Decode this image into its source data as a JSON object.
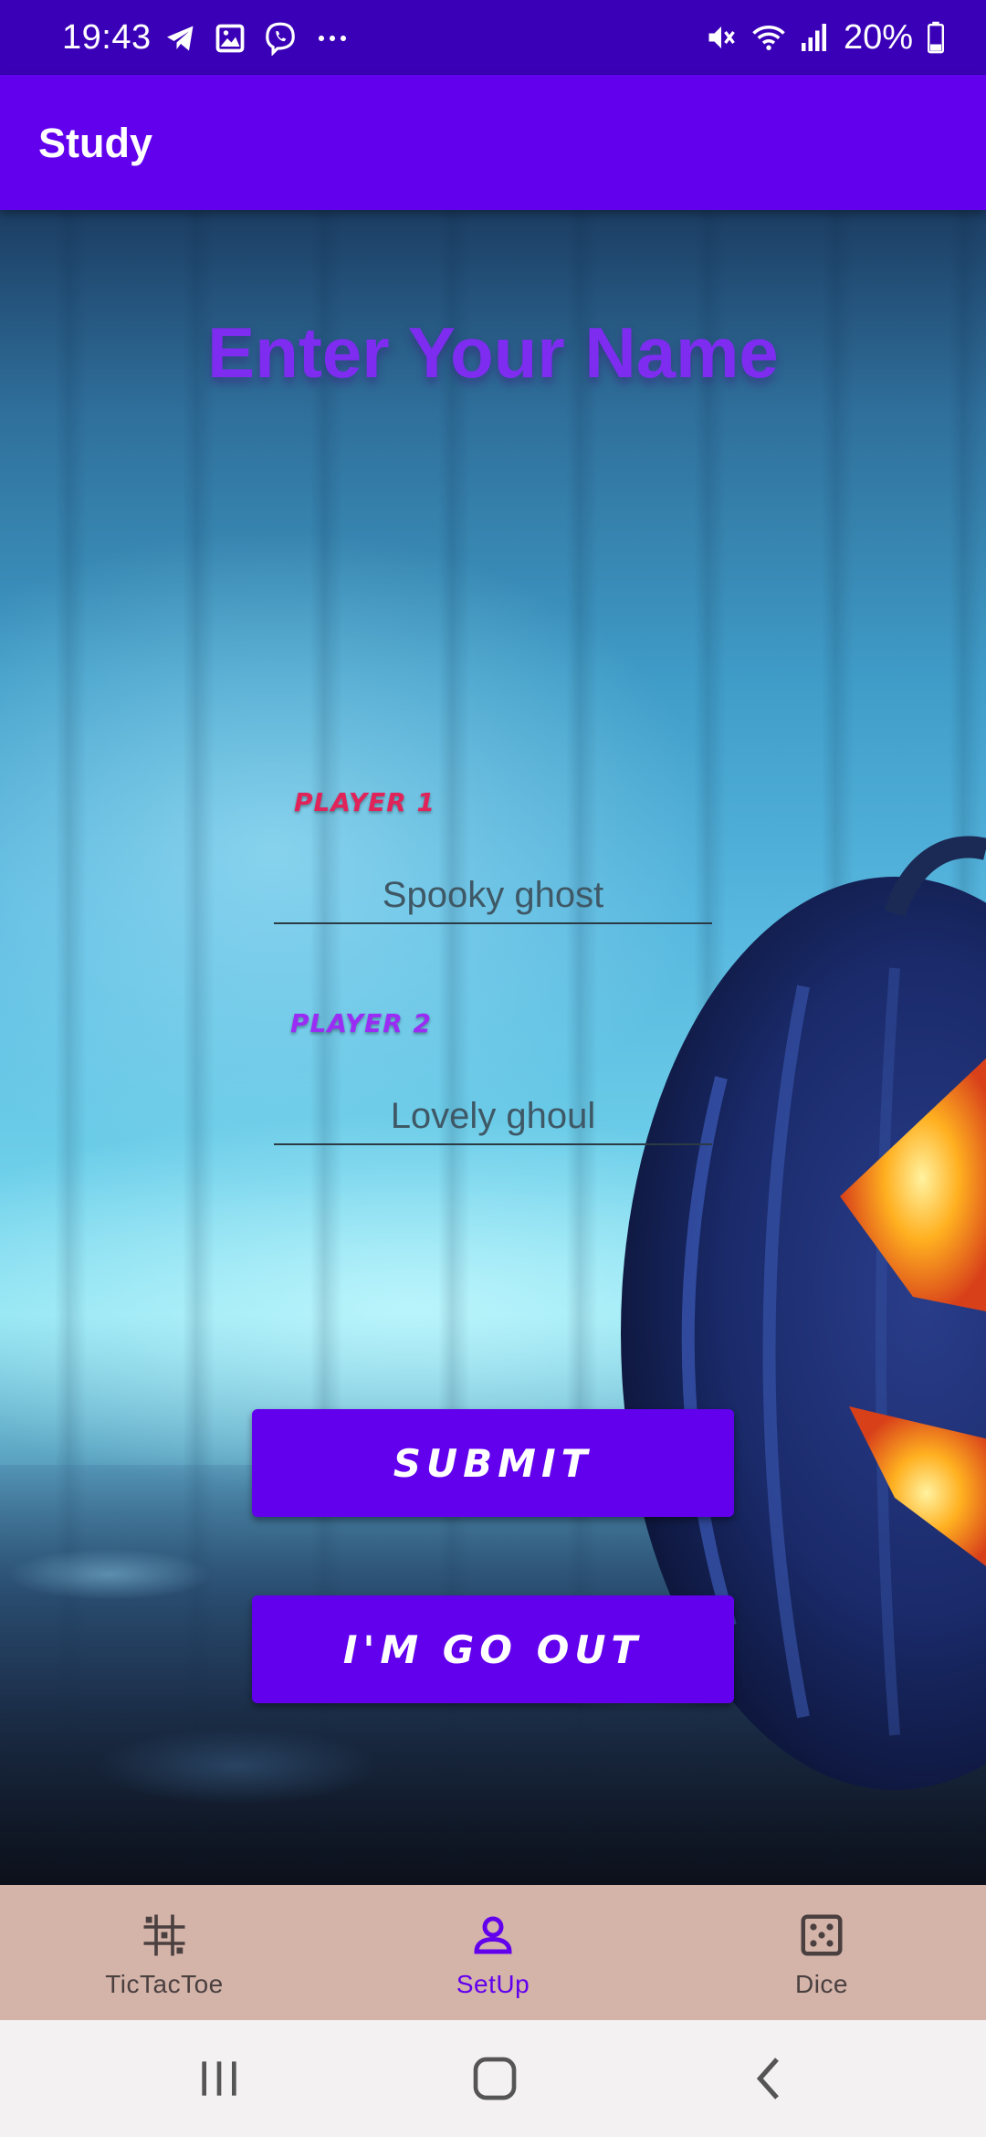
{
  "status_bar": {
    "time": "19:43",
    "left_icons": [
      "telegram-icon",
      "gallery-icon",
      "viber-icon",
      "more-dots-icon"
    ],
    "right_icons": [
      "mute-icon",
      "wifi-icon",
      "signal-icon"
    ],
    "battery_percent": "20%"
  },
  "app_bar": {
    "title": "Study"
  },
  "main": {
    "heading": "Enter Your Name",
    "player1": {
      "label": "PLAYER 1",
      "placeholder": "Spooky ghost"
    },
    "player2": {
      "label": "PLAYER 2",
      "placeholder": "Lovely ghoul"
    },
    "submit_label": "SUBMIT",
    "go_out_label": "I'M GO OUT"
  },
  "bottom_nav": {
    "items": [
      {
        "label": "TicTacToe",
        "icon": "grid-icon",
        "active": false
      },
      {
        "label": "SetUp",
        "icon": "person-icon",
        "active": true
      },
      {
        "label": "Dice",
        "icon": "dice-icon",
        "active": false
      }
    ]
  },
  "system_nav": {
    "buttons": [
      "recents-icon",
      "home-icon",
      "back-icon"
    ]
  },
  "colors": {
    "status_bar": "#3a00b7",
    "app_bar": "#6200ee",
    "heading": "#7d2cf0",
    "player1_label": "#e0245a",
    "player2_label": "#9b2cf5",
    "button": "#6200ee",
    "bottom_nav_bg": "#d4b3a9",
    "active_nav": "#6200ee"
  }
}
